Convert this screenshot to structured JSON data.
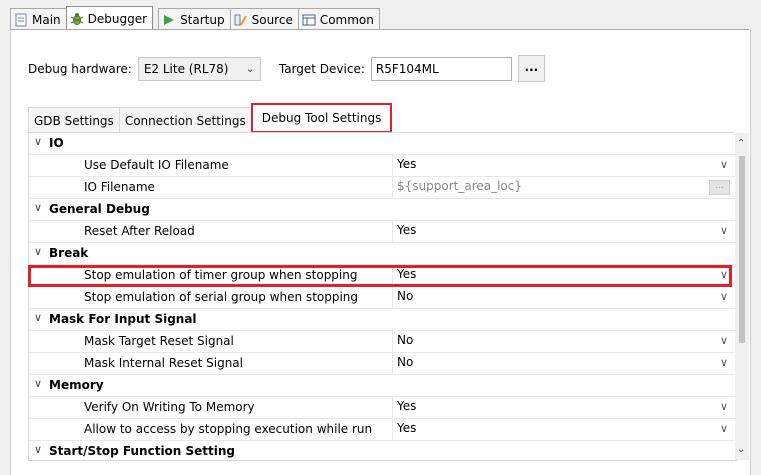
{
  "top_tabs": [
    {
      "label": "Main",
      "icon": "page-icon"
    },
    {
      "label": "Debugger",
      "icon": "bug-icon"
    },
    {
      "label": "Startup",
      "icon": "play-icon"
    },
    {
      "label": "Source",
      "icon": "source-icon"
    },
    {
      "label": "Common",
      "icon": "common-icon"
    }
  ],
  "hardware": {
    "label": "Debug hardware:",
    "value": "E2 Lite (RL78)",
    "target_label": "Target Device:",
    "target_value": "R5F104ML",
    "browse": "..."
  },
  "sub_tabs": [
    "GDB Settings",
    "Connection Settings",
    "Debug Tool Settings"
  ],
  "rows": [
    {
      "type": "cat",
      "name": "IO"
    },
    {
      "type": "child",
      "name": "Use Default IO Filename",
      "value": "Yes"
    },
    {
      "type": "child",
      "name": "IO Filename",
      "value": "${support_area_loc}"
    },
    {
      "type": "cat",
      "name": "General Debug"
    },
    {
      "type": "child",
      "name": "Reset After Reload",
      "value": "Yes"
    },
    {
      "type": "cat",
      "name": "Break"
    },
    {
      "type": "child",
      "name": "Stop emulation of timer group when stopping",
      "value": "Yes"
    },
    {
      "type": "child",
      "name": "Stop emulation of serial group when stopping",
      "value": "No"
    },
    {
      "type": "cat",
      "name": "Mask For Input Signal"
    },
    {
      "type": "child",
      "name": "Mask Target Reset Signal",
      "value": "No"
    },
    {
      "type": "child",
      "name": "Mask Internal Reset Signal",
      "value": "No"
    },
    {
      "type": "cat",
      "name": "Memory"
    },
    {
      "type": "child",
      "name": "Verify On Writing To Memory",
      "value": "Yes"
    },
    {
      "type": "child",
      "name": "Allow to access by stopping execution while run",
      "value": "Yes"
    },
    {
      "type": "cat",
      "name": "Start/Stop Function Setting"
    }
  ],
  "colors": {
    "highlight": "#e0202a"
  }
}
